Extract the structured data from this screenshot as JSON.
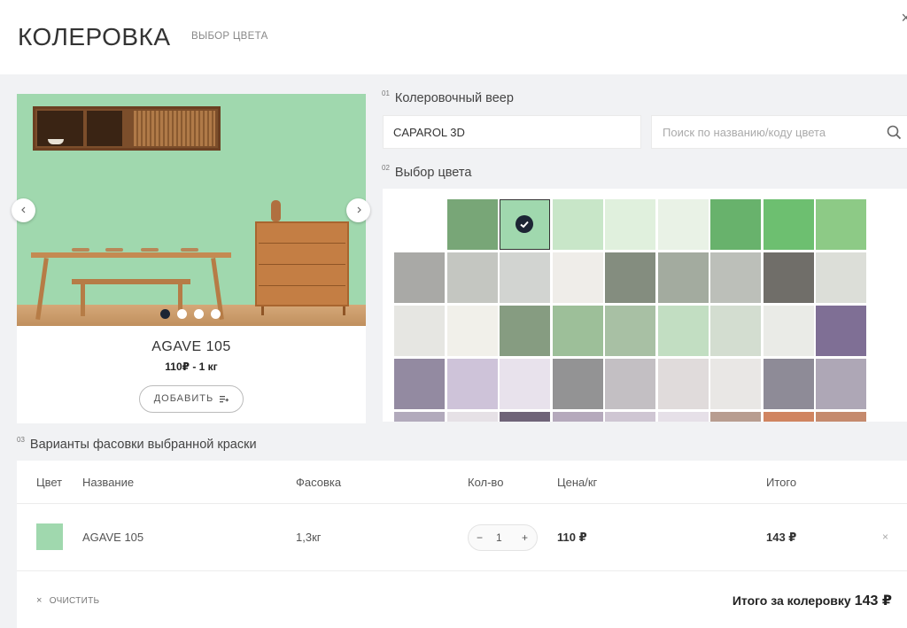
{
  "header": {
    "title": "КОЛЕРОВКА",
    "subtitle": "ВЫБОР ЦВЕТА",
    "close_icon": "×"
  },
  "product": {
    "name": "AGAVE 105",
    "price": "110₽ - 1 кг",
    "add_label": "ДОБАВИТЬ",
    "active_slide": 1,
    "slides_count": 4,
    "swatch_color": "#a0d8ae"
  },
  "sections": {
    "fan": {
      "num": "01",
      "label": "Колеровочный веер",
      "value": "CAPAROL 3D"
    },
    "color": {
      "num": "02",
      "label": "Выбор цвета"
    },
    "pack": {
      "num": "03",
      "label": "Варианты фасовки выбранной краски"
    }
  },
  "search": {
    "placeholder": "Поиск по названию/коду цвета"
  },
  "palette": {
    "selected": [
      0,
      2
    ],
    "rows": [
      [
        null,
        "#78a677",
        "#a0d8ae",
        "#c8e6c8",
        "#e0f0dd",
        "#e9f2e6",
        "#68b26c",
        "#6dbf70",
        "#8dca86"
      ],
      [
        "#a9a9a6",
        "#c4c6c1",
        "#d2d4d1",
        "#efede9",
        "#848d7f",
        "#a3ab9f",
        "#bcbfb9",
        "#706e69",
        "#dcded8"
      ],
      [
        "#e6e6e2",
        "#f1f0ea",
        "#869c81",
        "#9dbf99",
        "#a8c0a4",
        "#c2dec2",
        "#d3ddd0",
        "#eaebe7",
        "#7f6f95"
      ],
      [
        "#938aa1",
        "#cec3d9",
        "#e8e2ec",
        "#939394",
        "#c3bfc3",
        "#e0dbdb",
        "#e9e7e5",
        "#8e8b97",
        "#aea7b6"
      ],
      [
        "#b2aabc",
        "#e6e1e6",
        "#6f6478",
        "#b5a9bc",
        "#cfc6d3",
        "#e6e0e8",
        "#b89d90",
        "#d08460",
        "#c58a6d"
      ]
    ]
  },
  "table": {
    "headers": {
      "color": "Цвет",
      "name": "Название",
      "pack": "Фасовка",
      "qty": "Кол-во",
      "price": "Цена/кг",
      "total": "Итого"
    },
    "row": {
      "name": "AGAVE 105",
      "pack": "1,3кг",
      "qty": "1",
      "price": "110 ₽",
      "total": "143 ₽",
      "remove": "×"
    }
  },
  "stepper": {
    "minus": "−",
    "plus": "+"
  },
  "footer": {
    "clear_label": "ОЧИСТИТЬ",
    "clear_icon": "×",
    "total_label": "Итого за колеровку",
    "total_value": "143 ₽"
  }
}
